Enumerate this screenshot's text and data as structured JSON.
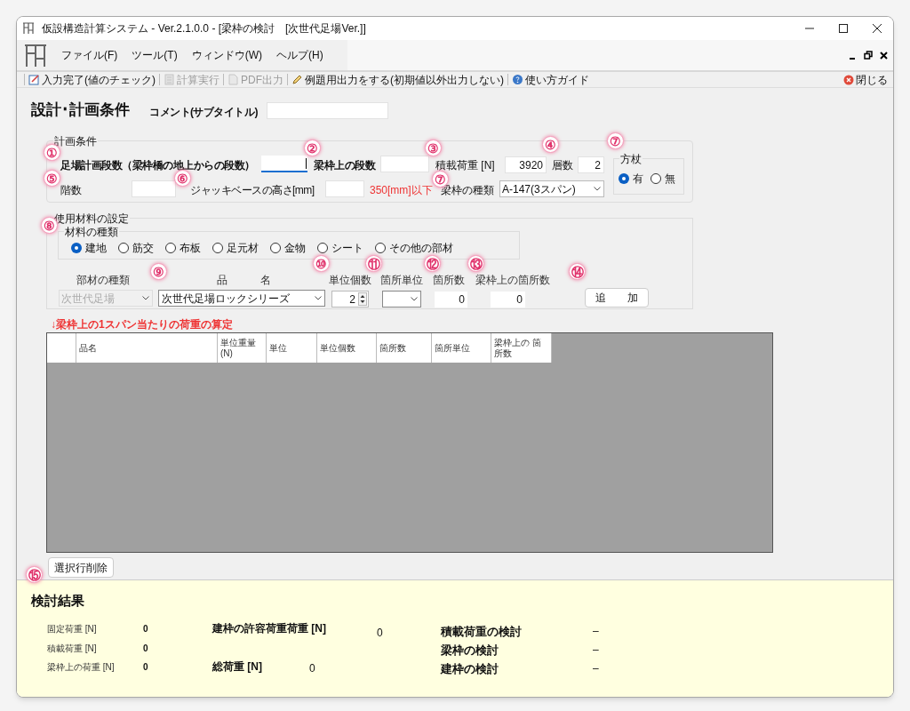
{
  "window": {
    "title": "仮設構造計算システム - Ver.2.1.0.0 - [梁枠の検討　[次世代足場Ver.]]"
  },
  "menu": [
    "ファイル(F)",
    "ツール(T)",
    "ウィンドウ(W)",
    "ヘルプ(H)"
  ],
  "toolbar": {
    "items": [
      {
        "kind": "check",
        "label": "入力完了(値のチェック)",
        "disabled": false
      },
      {
        "kind": "calc",
        "label": "計算実行",
        "disabled": true
      },
      {
        "kind": "pdf",
        "label": "PDF出力",
        "disabled": true
      },
      {
        "kind": "pen",
        "label": "例題用出力をする(初期値以外出力しない)",
        "disabled": false
      },
      {
        "kind": "help",
        "label": "使い方ガイド",
        "disabled": false
      }
    ],
    "close_button": "閉じる"
  },
  "design": {
    "heading": "設計･計画条件",
    "comment_label": "コメント(サブタイトル)"
  },
  "plan": {
    "title": "計画条件",
    "fields": [
      {
        "label": "足場計画段数（梁枠橋の地上からの段数）",
        "focused": true
      },
      {
        "label": "梁枠上の段数",
        "focused": false
      },
      {
        "label": "積載荷重 [N]",
        "value": "3920",
        "focused": false
      },
      {
        "label": "層数",
        "value": "2",
        "focused": false
      },
      {
        "label": "階数",
        "focused": false
      },
      {
        "label": "ジャッキベースの高さ[mm]",
        "focused": false
      }
    ],
    "jack_note": "350[mm]以下",
    "frame_type": {
      "label": "梁枠の種類",
      "value": "A-147(3スパン)"
    },
    "brace": {
      "title": "方杖",
      "options": [
        {
          "label": "有",
          "selected": true
        },
        {
          "label": "無",
          "selected": false
        }
      ]
    }
  },
  "materials": {
    "title": "使用材料の設定",
    "type_title": "材料の種類",
    "types": [
      {
        "label": "建地",
        "selected": true
      },
      {
        "label": "筋交",
        "selected": false
      },
      {
        "label": "布板",
        "selected": false
      },
      {
        "label": "足元材",
        "selected": false
      },
      {
        "label": "金物",
        "selected": false
      },
      {
        "label": "シート",
        "selected": false
      },
      {
        "label": "その他の部材",
        "selected": false
      }
    ],
    "column_labels": [
      "部材の種類",
      "品",
      "名",
      "単位個数",
      "箇所単位",
      "箇所数",
      "梁枠上の箇所数"
    ],
    "part_type": {
      "value": "次世代足場",
      "disabled": true
    },
    "product": {
      "value": "次世代足場ロックシリーズ"
    },
    "unit_count": "2",
    "place_count": "0",
    "beam_place_count": "0",
    "add_button": "追　　加"
  },
  "load_note": "↓梁枠上の1スパン当たりの荷重の算定",
  "table": {
    "columns": [
      "品名",
      "単位重量 (N)",
      "単位",
      "単位個数",
      "箇所数",
      "箇所単位",
      "梁枠上の 箇所数"
    ]
  },
  "delete_button": "選択行削除",
  "annotations": [
    "①",
    "②",
    "③",
    "④",
    "⑤",
    "⑥",
    "⑦",
    "⑦",
    "⑧",
    "⑨",
    "⑩",
    "⑪",
    "⑫",
    "⑬",
    "⑭",
    "⑮"
  ],
  "results": {
    "title": "検討結果",
    "loads": [
      {
        "label": "固定荷重 [N]",
        "value": "0"
      },
      {
        "label": "積載荷重 [N]",
        "value": "0"
      },
      {
        "label": "梁枠上の荷重 [N]",
        "value": "0"
      }
    ],
    "allowable": {
      "label": "建枠の許容荷重荷重 [N]",
      "value": "0"
    },
    "total": {
      "label": "総荷重 [N]",
      "value": "0"
    },
    "checks": [
      {
        "label": "積載荷重の検討",
        "value": "–"
      },
      {
        "label": "梁枠の検討",
        "value": "–"
      },
      {
        "label": "建枠の検討",
        "value": "–"
      }
    ]
  }
}
